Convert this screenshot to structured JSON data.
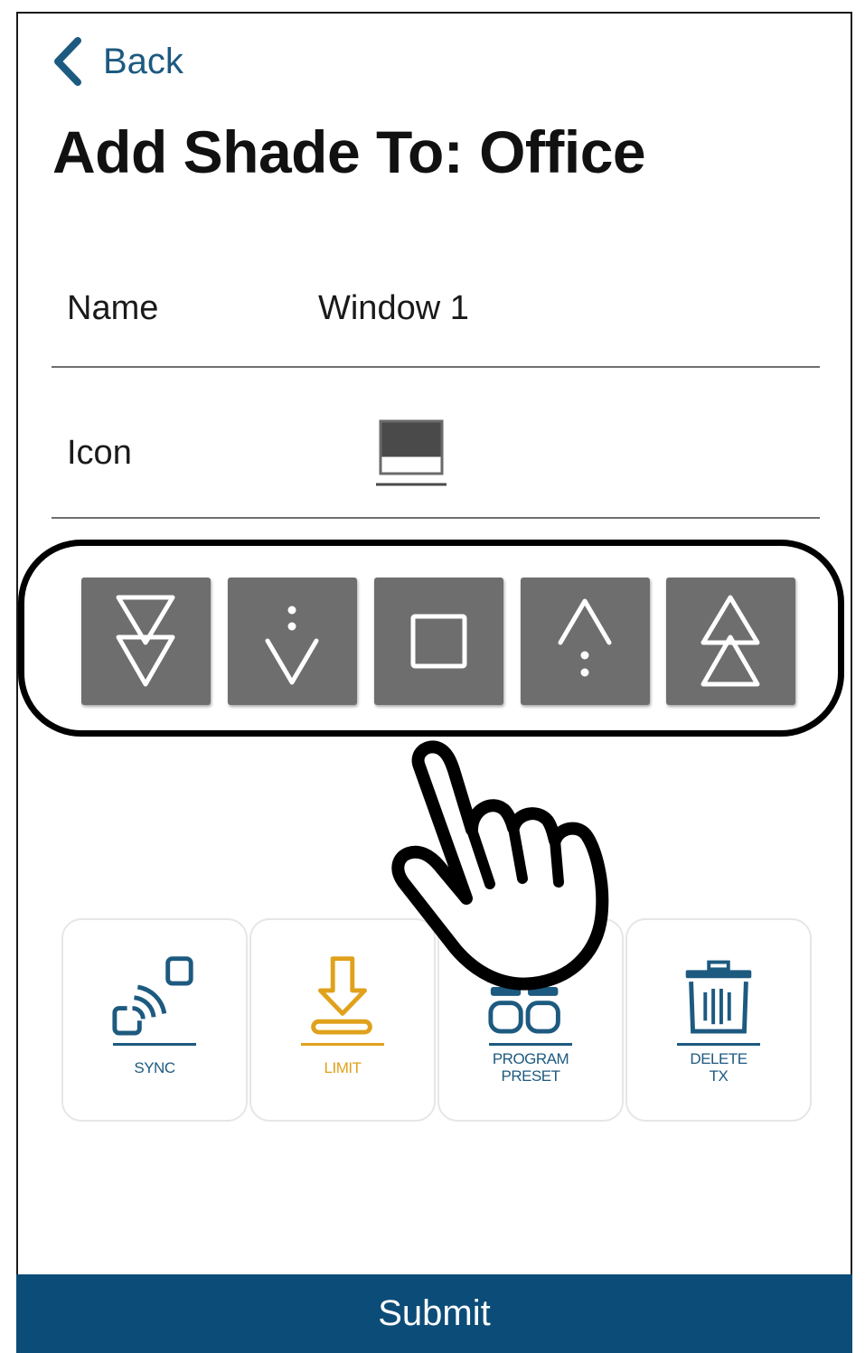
{
  "header": {
    "back_label": "Back",
    "title": "Add Shade To: Office"
  },
  "form": {
    "name_label": "Name",
    "name_value": "Window 1",
    "icon_label": "Icon"
  },
  "controls": [
    {
      "name": "full-down",
      "icon": "double-down-triangle-icon"
    },
    {
      "name": "step-down",
      "icon": "dotted-down-arrow-icon"
    },
    {
      "name": "stop",
      "icon": "stop-square-icon"
    },
    {
      "name": "step-up",
      "icon": "dotted-up-arrow-icon"
    },
    {
      "name": "full-up",
      "icon": "double-up-triangle-icon"
    }
  ],
  "actions": [
    {
      "label_lines": [
        "SYNC"
      ],
      "color": "#1d5a80",
      "icon": "sync-icon"
    },
    {
      "label_lines": [
        "LIMIT"
      ],
      "color": "#e0a11b",
      "icon": "limit-icon"
    },
    {
      "label_lines": [
        "PROGRAM",
        "PRESET"
      ],
      "color": "#1d5a80",
      "icon": "program-preset-icon"
    },
    {
      "label_lines": [
        "DELETE",
        "TX"
      ],
      "color": "#1d5a80",
      "icon": "trash-icon"
    }
  ],
  "footer": {
    "submit_label": "Submit"
  },
  "colors": {
    "accent": "#0c4c78",
    "button_gray": "#6e6e6e",
    "limit": "#e0a11b",
    "link": "#1d5a80"
  },
  "overlay": {
    "icon": "pointing-hand-icon"
  }
}
